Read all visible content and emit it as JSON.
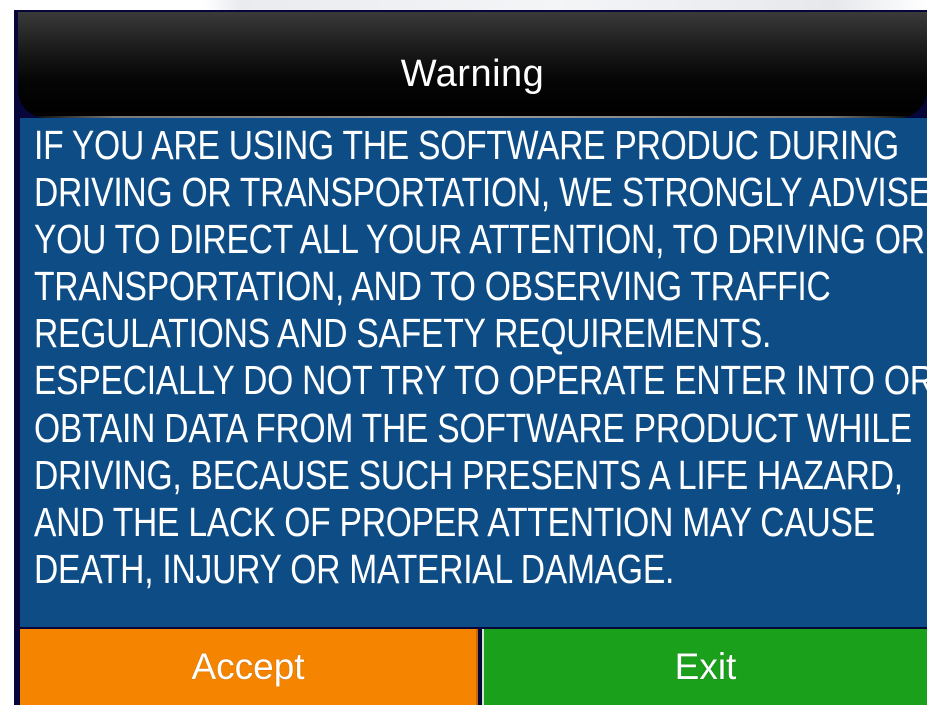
{
  "dialog": {
    "title": "Warning",
    "message_lines": [
      "IF YOU ARE USING THE SOFTWARE PRODUC DURING",
      "DRIVING OR TRANSPORTATION, WE STRONGLY ADVISE",
      "YOU TO DIRECT ALL YOUR ATTENTION, TO DRIVING OR",
      "TRANSPORTATION, AND TO OBSERVING TRAFFIC",
      "REGULATIONS AND SAFETY REQUIREMENTS.",
      "ESPECIALLY DO NOT TRY TO OPERATE ENTER INTO OR",
      "OBTAIN DATA FROM THE SOFTWARE PRODUCT WHILE",
      "DRIVING, BECAUSE SUCH PRESENTS A LIFE HAZARD,",
      "AND THE LACK OF PROPER ATTENTION MAY CAUSE",
      "DEATH, INJURY OR MATERIAL DAMAGE."
    ],
    "buttons": {
      "accept_label": "Accept",
      "exit_label": "Exit"
    }
  },
  "colors": {
    "header_bg": "#000000",
    "message_bg": "#0e4c86",
    "accept_bg": "#f58400",
    "exit_bg": "#1aa01a",
    "text": "#ffffff"
  }
}
